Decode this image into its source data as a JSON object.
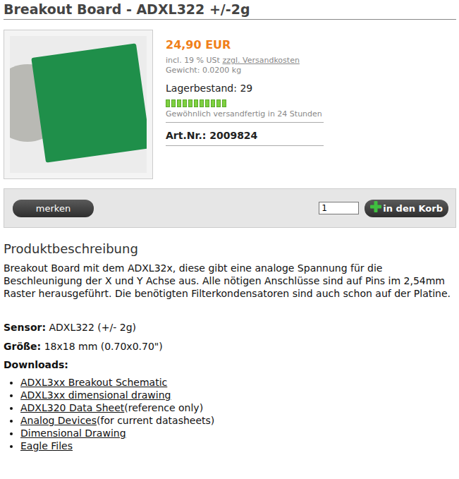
{
  "title": "Breakout Board - ADXL322 +/-2g",
  "price": "24,90 EUR",
  "tax_note": {
    "text": "incl. 19 % USt",
    "link": "zzgl. Versandkosten"
  },
  "weight": "Gewicht: 0.0200 kg",
  "stock": {
    "label": "Lagerbestand: 29",
    "level": 1
  },
  "shipping": "Gewöhnlich versandfertig in 24 Stunden",
  "article_number": "Art.Nr.: 2009824",
  "actions": {
    "bookmark": "merken",
    "quantity": "1",
    "cart": "in den Korb"
  },
  "description": {
    "heading": "Produktbeschreibung",
    "text": "Breakout Board mit dem ADXL32x, diese gibt eine analoge Spannung für die Beschleunigung der X und Y Achse aus. Alle nötigen Anschlüsse sind auf Pins im 2,54mm Raster herausgeführt. Die benötigten Filterkondensatoren sind auch schon auf der Platine."
  },
  "specs": [
    {
      "label": "Sensor:",
      "value": "ADXL322 (+/- 2g)"
    },
    {
      "label": "Größe:",
      "value": "18x18 mm (0.70x0.70\")"
    }
  ],
  "downloads": {
    "label": "Downloads:",
    "items": [
      {
        "link": "ADXL3xx Breakout Schematic"
      },
      {
        "link": "ADXL3xx dimensional drawing"
      },
      {
        "link": "ADXL320 Data Sheet",
        "note": "(reference only)"
      },
      {
        "link": "Analog Devices",
        "note": "(for current datasheets)"
      },
      {
        "link": "Dimensional Drawing"
      },
      {
        "link": "Eagle Files"
      }
    ]
  }
}
